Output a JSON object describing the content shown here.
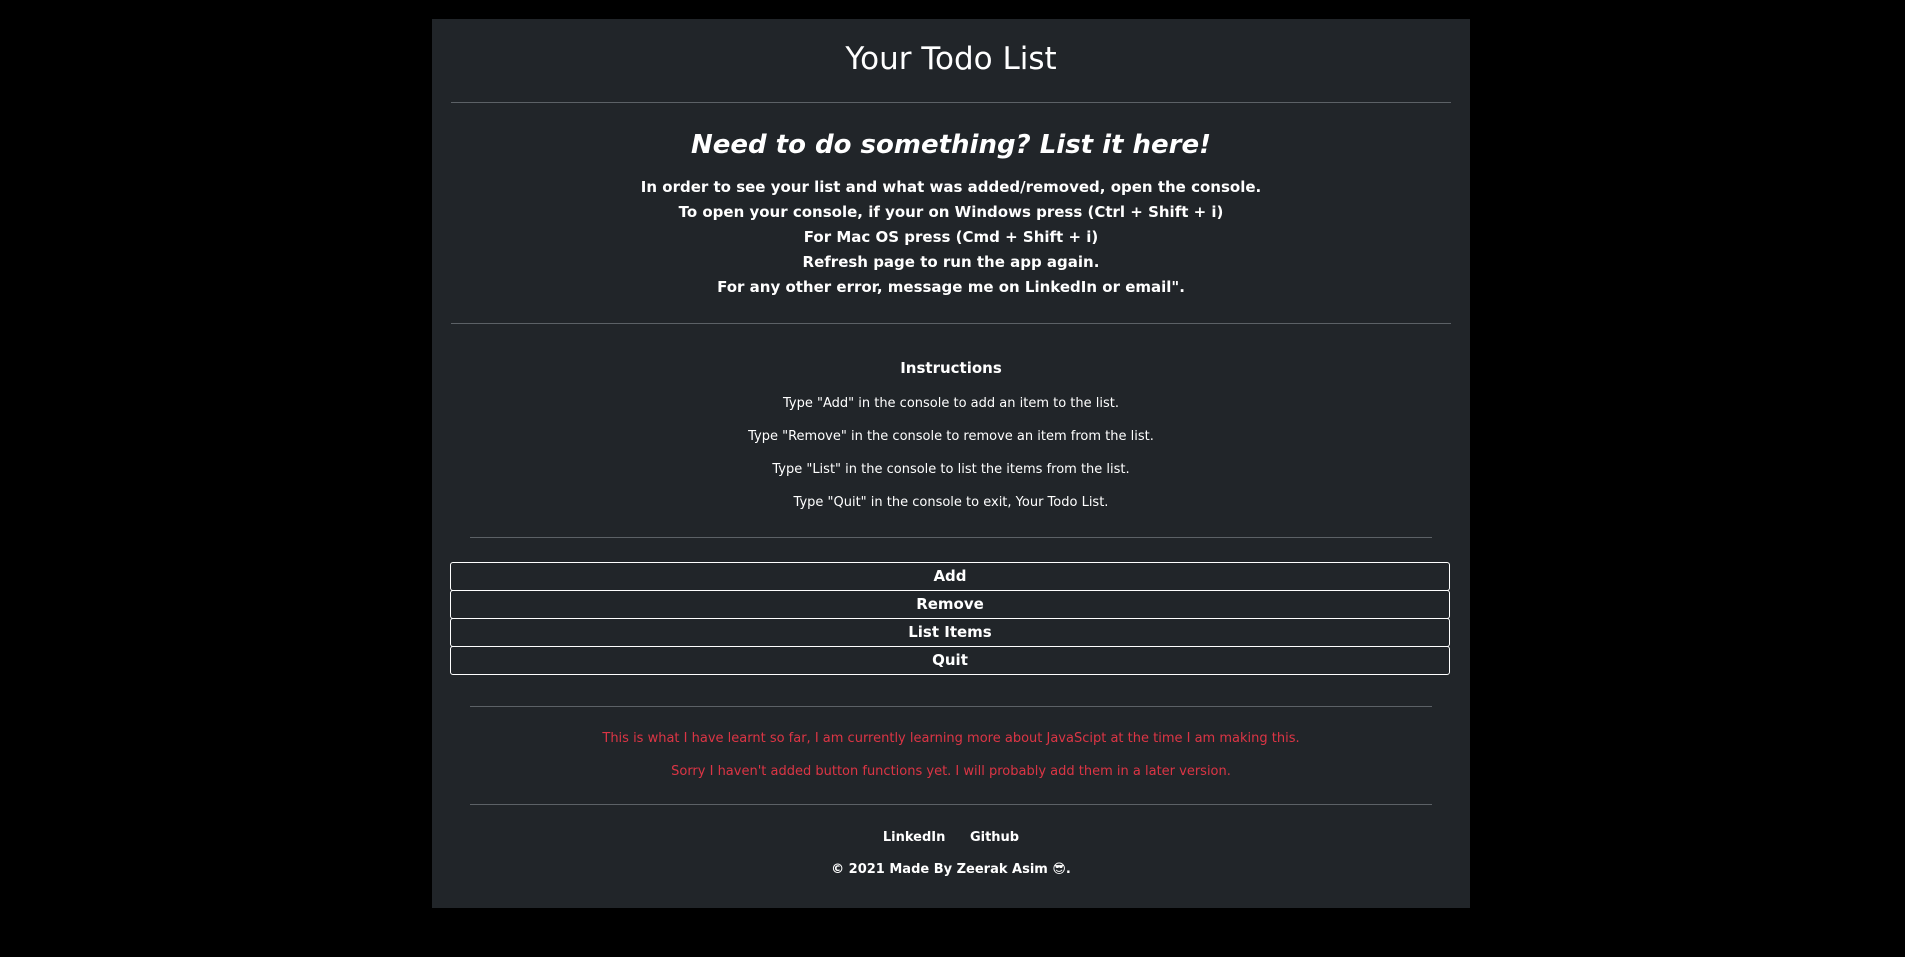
{
  "header": {
    "title": "Your Todo List"
  },
  "intro": {
    "heading": "Need to do something? List it here!",
    "lines": [
      "In order to see your list and what was added/removed, open the console.",
      "To open your console, if your on Windows press (Ctrl + Shift + i)",
      "For Mac OS press (Cmd + Shift + i)",
      "Refresh page to run the app again.",
      "For any other error, message me on LinkedIn or email\"."
    ]
  },
  "instructions": {
    "title": "Instructions",
    "items": [
      "Type \"Add\" in the console to add an item to the list.",
      "Type \"Remove\" in the console to remove an item from the list.",
      "Type \"List\" in the console to list the items from the list.",
      "Type \"Quit\" in the console to exit, Your Todo List."
    ]
  },
  "buttons": {
    "add": "Add",
    "remove": "Remove",
    "list_items": "List Items",
    "quit": "Quit"
  },
  "notes": [
    "This is what I have learnt so far, I am currently learning more about JavaScipt at the time I am making this.",
    "Sorry I haven't added button functions yet. I will probably add them in a later version."
  ],
  "footer": {
    "linkedin": "LinkedIn",
    "github": "Github",
    "copyright": "© 2021 Made By Zeerak Asim 😎."
  },
  "colors": {
    "background": "#000000",
    "panel": "#212529",
    "text": "#ffffff",
    "note": "#dc3545",
    "divider": "#5c6166"
  }
}
